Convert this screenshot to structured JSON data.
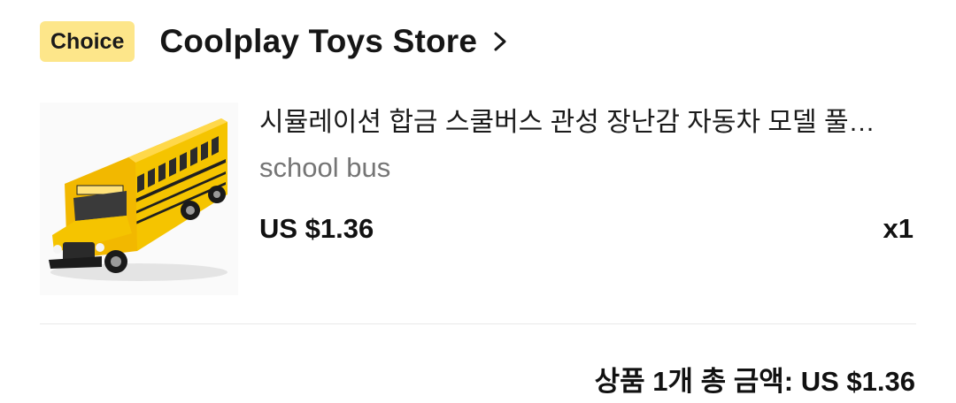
{
  "store": {
    "badge": "Choice",
    "name": "Coolplay Toys Store",
    "chevron_icon": "chevron-right-icon"
  },
  "item": {
    "image_icon": "school-bus-toy",
    "title": "시뮬레이션 합금 스쿨버스 관성 장난감 자동차 모델 풀…",
    "variant": "school bus",
    "price": "US $1.36",
    "quantity": "x1"
  },
  "summary": {
    "total_text": "상품 1개 총 금액: US $1.36"
  },
  "colors": {
    "badge_bg": "#fde68a",
    "bus_yellow": "#f5c400",
    "variant_text": "#757575"
  }
}
